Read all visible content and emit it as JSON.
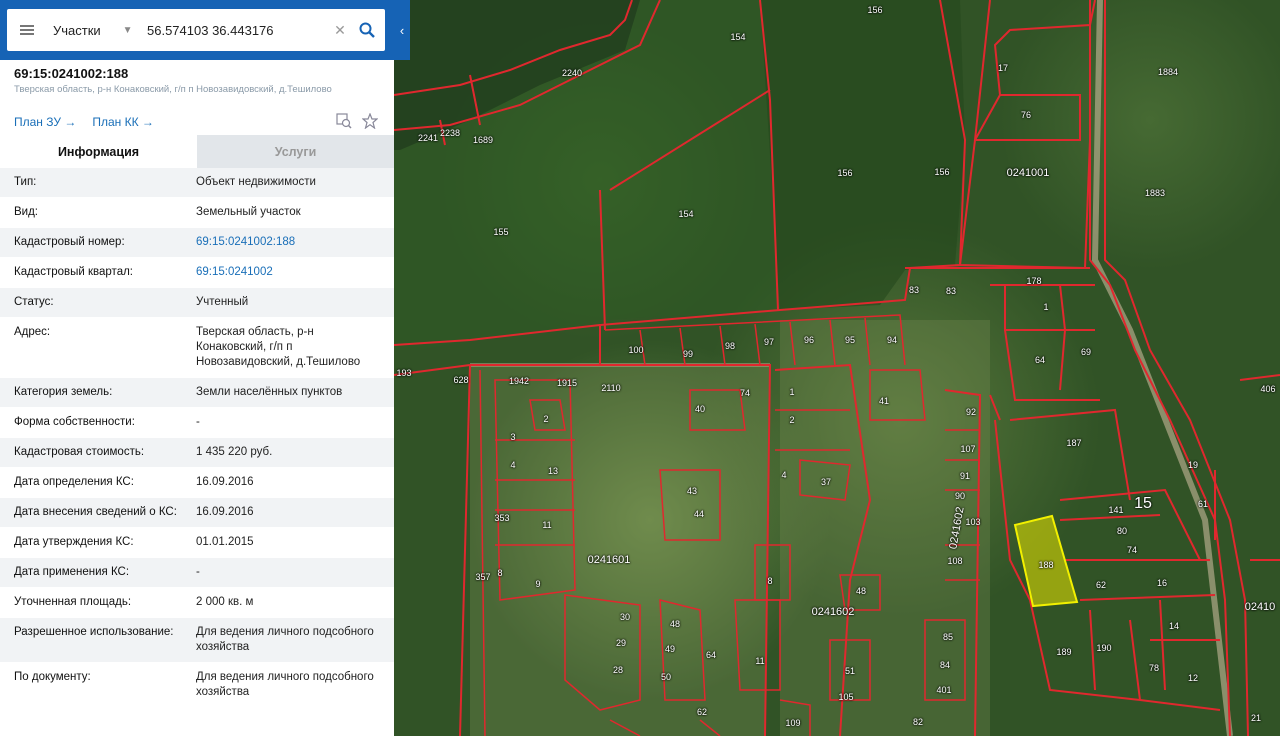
{
  "search": {
    "type_label": "Участки",
    "query": "56.574103 36.443176"
  },
  "object": {
    "title": "69:15:0241002:188",
    "address": "Тверская область, р-н Конаковский, г/п п Новозавидовский, д.Тешилово",
    "plan_zu": "План ЗУ →",
    "plan_kk": "План КК →"
  },
  "tabs": [
    {
      "label": "Информация",
      "active": true
    },
    {
      "label": "Услуги",
      "active": false
    }
  ],
  "info_rows": [
    {
      "label": "Тип:",
      "value": "Объект недвижимости",
      "link": false
    },
    {
      "label": "Вид:",
      "value": "Земельный участок",
      "link": false
    },
    {
      "label": "Кадастровый номер:",
      "value": "69:15:0241002:188",
      "link": true
    },
    {
      "label": "Кадастровый квартал:",
      "value": "69:15:0241002",
      "link": true
    },
    {
      "label": "Статус:",
      "value": "Учтенный",
      "link": false
    },
    {
      "label": "Адрес:",
      "value": "Тверская область, р-н Конаковский, г/п п Новозавидовский, д.Тешилово",
      "link": false
    },
    {
      "label": "Категория земель:",
      "value": "Земли населённых пунктов",
      "link": false
    },
    {
      "label": "Форма собственности:",
      "value": "-",
      "link": false
    },
    {
      "label": "Кадастровая стоимость:",
      "value": "1 435 220 руб.",
      "link": false
    },
    {
      "label": "Дата определения КС:",
      "value": "16.09.2016",
      "link": false
    },
    {
      "label": "Дата внесения сведений о КС:",
      "value": "16.09.2016",
      "link": false
    },
    {
      "label": "Дата утверждения КС:",
      "value": "01.01.2015",
      "link": false
    },
    {
      "label": "Дата применения КС:",
      "value": "-",
      "link": false
    },
    {
      "label": "Уточненная площадь:",
      "value": "2 000 кв. м",
      "link": false
    },
    {
      "label": "Разрешенное использование:",
      "value": "Для ведения личного подсобного хозяйства",
      "link": false
    },
    {
      "label": "По документу:",
      "value": "Для ведения личного подсобного хозяйства",
      "link": false
    }
  ],
  "map": {
    "highlight_color": "#e8e600",
    "boundary_color": "#e0282e",
    "labels": [
      {
        "t": "156",
        "k": "p"
      },
      {
        "t": "154",
        "k": "p"
      },
      {
        "t": "2240",
        "k": "p"
      },
      {
        "t": "2241",
        "k": "p"
      },
      {
        "t": "2238",
        "k": "p"
      },
      {
        "t": "1689",
        "k": "p"
      },
      {
        "t": "156",
        "k": "p"
      },
      {
        "t": "156",
        "k": "p"
      },
      {
        "t": "154",
        "k": "p"
      },
      {
        "t": "155",
        "k": "p"
      },
      {
        "t": "17",
        "k": "p"
      },
      {
        "t": "76",
        "k": "p"
      },
      {
        "t": "0241001",
        "k": "b"
      },
      {
        "t": "1884",
        "k": "p"
      },
      {
        "t": "1883",
        "k": "p"
      },
      {
        "t": "178",
        "k": "p"
      },
      {
        "t": "1",
        "k": "p"
      },
      {
        "t": "83",
        "k": "p"
      },
      {
        "t": "83",
        "k": "p"
      },
      {
        "t": "100",
        "k": "p"
      },
      {
        "t": "99",
        "k": "p"
      },
      {
        "t": "98",
        "k": "p"
      },
      {
        "t": "97",
        "k": "p"
      },
      {
        "t": "96",
        "k": "p"
      },
      {
        "t": "95",
        "k": "p"
      },
      {
        "t": "94",
        "k": "p"
      },
      {
        "t": "64",
        "k": "p"
      },
      {
        "t": "69",
        "k": "p"
      },
      {
        "t": "193",
        "k": "p"
      },
      {
        "t": "628",
        "k": "p"
      },
      {
        "t": "1942",
        "k": "p"
      },
      {
        "t": "1915",
        "k": "p"
      },
      {
        "t": "2110",
        "k": "p"
      },
      {
        "t": "74",
        "k": "p"
      },
      {
        "t": "1",
        "k": "p"
      },
      {
        "t": "41",
        "k": "p"
      },
      {
        "t": "92",
        "k": "p"
      },
      {
        "t": "406",
        "k": "p"
      },
      {
        "t": "2",
        "k": "p"
      },
      {
        "t": "40",
        "k": "p"
      },
      {
        "t": "2",
        "k": "p"
      },
      {
        "t": "3",
        "k": "p"
      },
      {
        "t": "107",
        "k": "p"
      },
      {
        "t": "187",
        "k": "p"
      },
      {
        "t": "19",
        "k": "p"
      },
      {
        "t": "4",
        "k": "p"
      },
      {
        "t": "13",
        "k": "p"
      },
      {
        "t": "4",
        "k": "p"
      },
      {
        "t": "37",
        "k": "p"
      },
      {
        "t": "91",
        "k": "p"
      },
      {
        "t": "43",
        "k": "p"
      },
      {
        "t": "90",
        "k": "p"
      },
      {
        "t": "141",
        "k": "p"
      },
      {
        "t": "15",
        "k": "g"
      },
      {
        "t": "61",
        "k": "p"
      },
      {
        "t": "353",
        "k": "p"
      },
      {
        "t": "11",
        "k": "p"
      },
      {
        "t": "44",
        "k": "p"
      },
      {
        "t": "103",
        "k": "p"
      },
      {
        "t": "80",
        "k": "p"
      },
      {
        "t": "0241601",
        "k": "b"
      },
      {
        "t": "108",
        "k": "p"
      },
      {
        "t": "188",
        "k": "p"
      },
      {
        "t": "74",
        "k": "p"
      },
      {
        "t": "357",
        "k": "p"
      },
      {
        "t": "8",
        "k": "p"
      },
      {
        "t": "9",
        "k": "p"
      },
      {
        "t": "8",
        "k": "p"
      },
      {
        "t": "48",
        "k": "p"
      },
      {
        "t": "62",
        "k": "p"
      },
      {
        "t": "16",
        "k": "p"
      },
      {
        "t": "0241602",
        "k": "b"
      },
      {
        "t": "02410",
        "k": "b"
      },
      {
        "t": "30",
        "k": "p"
      },
      {
        "t": "48",
        "k": "p"
      },
      {
        "t": "85",
        "k": "p"
      },
      {
        "t": "14",
        "k": "p"
      },
      {
        "t": "29",
        "k": "p"
      },
      {
        "t": "49",
        "k": "p"
      },
      {
        "t": "64",
        "k": "p"
      },
      {
        "t": "189",
        "k": "p"
      },
      {
        "t": "190",
        "k": "p"
      },
      {
        "t": "11",
        "k": "p"
      },
      {
        "t": "84",
        "k": "p"
      },
      {
        "t": "78",
        "k": "p"
      },
      {
        "t": "28",
        "k": "p"
      },
      {
        "t": "51",
        "k": "p"
      },
      {
        "t": "50",
        "k": "p"
      },
      {
        "t": "12",
        "k": "p"
      },
      {
        "t": "401",
        "k": "p"
      },
      {
        "t": "105",
        "k": "p"
      },
      {
        "t": "62",
        "k": "p"
      },
      {
        "t": "109",
        "k": "p"
      },
      {
        "t": "82",
        "k": "p"
      },
      {
        "t": "21",
        "k": "p"
      },
      {
        "t": "0241602",
        "k": "b"
      }
    ]
  }
}
